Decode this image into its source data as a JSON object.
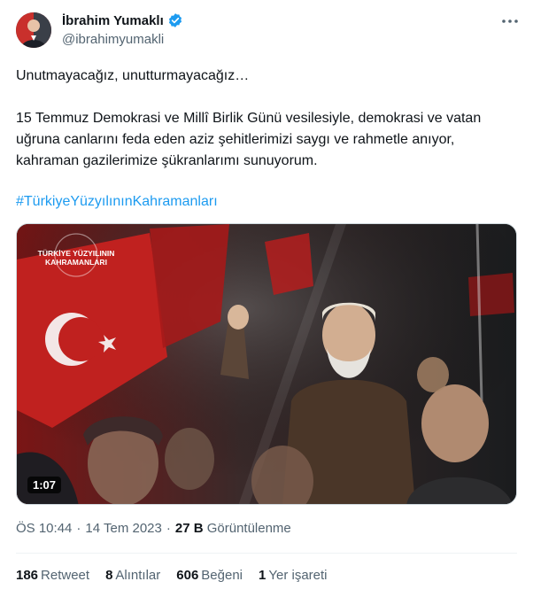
{
  "author": {
    "name": "İbrahim Yumaklı",
    "handle": "@ibrahimyumakli",
    "verified": true
  },
  "tweet": {
    "line1": "Unutmayacağız, unutturmayacağız…",
    "paragraph2": "15 Temmuz Demokrasi ve Millî Birlik Günü vesilesiyle, demokrasi ve vatan uğruna canlarını feda eden aziz şehitlerimizi saygı ve rahmetle anıyor, kahraman gazilerimize şükranlarımı sunuyorum.",
    "hashtag": "#TürkiyeYüzyılınınKahramanları"
  },
  "media": {
    "logo_line1": "TÜRKİYE YÜZYILININ",
    "logo_line2": "KAHRAMANLARI",
    "duration": "1:07"
  },
  "meta": {
    "time": "ÖS 10:44",
    "date": "14 Tem 2023",
    "separator": "·",
    "views_count": "27 B",
    "views_label": "Görüntülenme"
  },
  "stats": {
    "retweets_count": "186",
    "retweets_label": "Retweet",
    "quotes_count": "8",
    "quotes_label": "Alıntılar",
    "likes_count": "606",
    "likes_label": "Beğeni",
    "bookmarks_count": "1",
    "bookmarks_label": "Yer işareti"
  },
  "colors": {
    "accent": "#1d9bf0",
    "text": "#0f1419",
    "secondary": "#536471"
  },
  "icons": {
    "verified": "verified-badge-icon",
    "more": "more-options-icon"
  }
}
